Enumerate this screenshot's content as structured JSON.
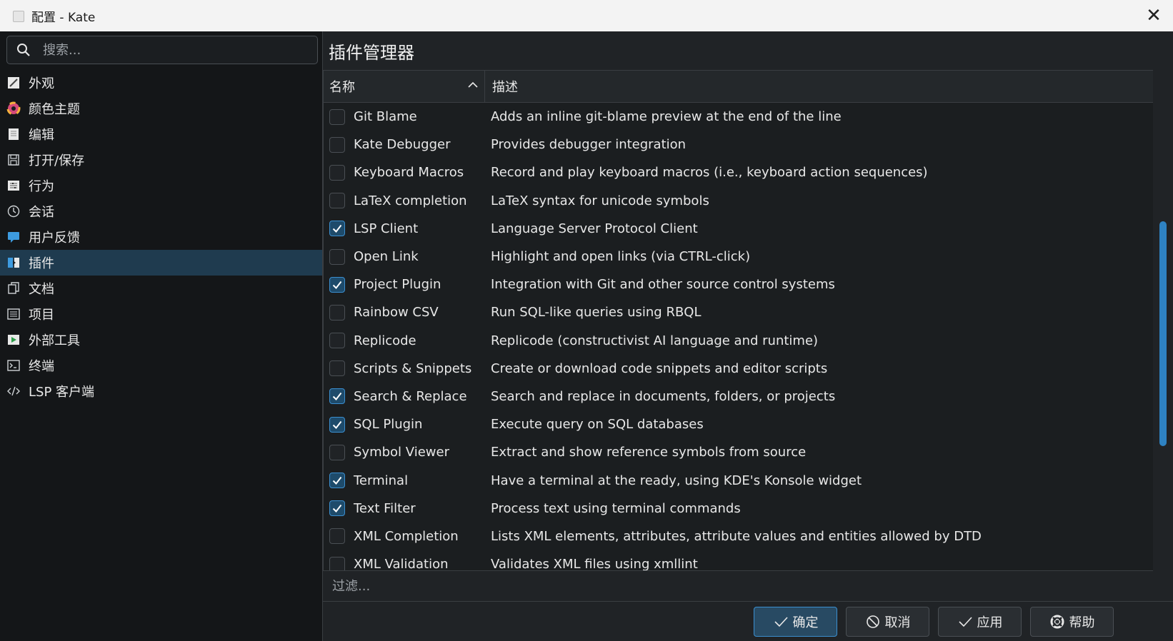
{
  "window": {
    "title": "配置 - Kate",
    "close_glyph": "✕"
  },
  "sidebar": {
    "search_placeholder": "搜索...",
    "items": [
      {
        "label": "外观",
        "icon": "appearance-icon",
        "active": false
      },
      {
        "label": "颜色主题",
        "icon": "color-theme-icon",
        "active": false
      },
      {
        "label": "编辑",
        "icon": "edit-icon",
        "active": false
      },
      {
        "label": "打开/保存",
        "icon": "save-icon",
        "active": false
      },
      {
        "label": "行为",
        "icon": "behavior-icon",
        "active": false
      },
      {
        "label": "会话",
        "icon": "session-clock-icon",
        "active": false
      },
      {
        "label": "用户反馈",
        "icon": "feedback-icon",
        "active": false
      },
      {
        "label": "插件",
        "icon": "plugin-icon",
        "active": true
      },
      {
        "label": "文档",
        "icon": "documents-icon",
        "active": false
      },
      {
        "label": "项目",
        "icon": "projects-icon",
        "active": false
      },
      {
        "label": "外部工具",
        "icon": "external-tools-icon",
        "active": false
      },
      {
        "label": "终端",
        "icon": "terminal-icon",
        "active": false
      },
      {
        "label": "LSP 客户端",
        "icon": "lsp-code-icon",
        "active": false
      }
    ]
  },
  "main": {
    "title": "插件管理器",
    "columns": {
      "name": "名称",
      "description": "描述"
    },
    "plugins": [
      {
        "name": "Git Blame",
        "description": "Adds an inline git-blame preview at the end of the line",
        "checked": false
      },
      {
        "name": "Kate Debugger",
        "description": "Provides debugger integration",
        "checked": false
      },
      {
        "name": "Keyboard Macros",
        "description": "Record and play keyboard macros (i.e., keyboard action sequences)",
        "checked": false
      },
      {
        "name": "LaTeX completion",
        "description": "LaTeX syntax for unicode symbols",
        "checked": false
      },
      {
        "name": "LSP Client",
        "description": "Language Server Protocol Client",
        "checked": true
      },
      {
        "name": "Open Link",
        "description": "Highlight and open links (via CTRL-click)",
        "checked": false
      },
      {
        "name": "Project Plugin",
        "description": "Integration with Git and other source control systems",
        "checked": true
      },
      {
        "name": "Rainbow CSV",
        "description": "Run SQL-like queries using RBQL",
        "checked": false
      },
      {
        "name": "Replicode",
        "description": "Replicode (constructivist AI language and runtime)",
        "checked": false
      },
      {
        "name": "Scripts & Snippets",
        "description": "Create or download code snippets and editor scripts",
        "checked": false
      },
      {
        "name": "Search & Replace",
        "description": "Search and replace in documents, folders, or projects",
        "checked": true
      },
      {
        "name": "SQL Plugin",
        "description": "Execute query on SQL databases",
        "checked": true
      },
      {
        "name": "Symbol Viewer",
        "description": "Extract and show reference symbols from source",
        "checked": false
      },
      {
        "name": "Terminal",
        "description": "Have a terminal at the ready, using KDE's Konsole widget",
        "checked": true
      },
      {
        "name": "Text Filter",
        "description": "Process text using terminal commands",
        "checked": true
      },
      {
        "name": "XML Completion",
        "description": "Lists XML elements, attributes, attribute values and entities allowed by DTD",
        "checked": false
      },
      {
        "name": "XML Validation",
        "description": "Validates XML files using xmllint",
        "checked": false
      }
    ],
    "filter_placeholder": "过滤...",
    "scroll_position": 0.55,
    "scroll_visible_fraction": 0.45
  },
  "buttons": {
    "ok": "确定",
    "cancel": "取消",
    "apply": "应用",
    "help": "帮助"
  },
  "colors": {
    "accent": "#3b8fd0",
    "selection": "#1f3b4f",
    "background": "#202326"
  }
}
